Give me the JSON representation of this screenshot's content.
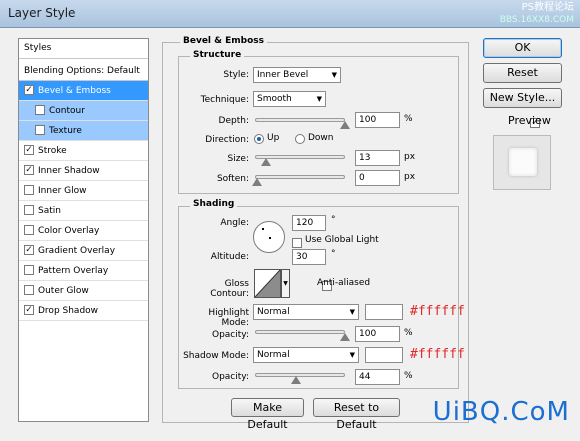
{
  "window": {
    "title": "Layer Style",
    "watermark_top_line1": "PS教程论坛",
    "watermark_top_line2": "BBS.16XX8.COM"
  },
  "sidebar": {
    "header": "Styles",
    "blending": "Blending Options: Default",
    "items": [
      {
        "label": "Bevel & Emboss",
        "checked": true
      },
      {
        "label": "Contour",
        "checked": false
      },
      {
        "label": "Texture",
        "checked": false
      },
      {
        "label": "Stroke",
        "checked": true
      },
      {
        "label": "Inner Shadow",
        "checked": true
      },
      {
        "label": "Inner Glow",
        "checked": false
      },
      {
        "label": "Satin",
        "checked": false
      },
      {
        "label": "Color Overlay",
        "checked": false
      },
      {
        "label": "Gradient Overlay",
        "checked": true
      },
      {
        "label": "Pattern Overlay",
        "checked": false
      },
      {
        "label": "Outer Glow",
        "checked": false
      },
      {
        "label": "Drop Shadow",
        "checked": true
      }
    ]
  },
  "bevel": {
    "title": "Bevel & Emboss",
    "structure_title": "Structure",
    "style_label": "Style:",
    "style_value": "Inner Bevel",
    "technique_label": "Technique:",
    "technique_value": "Smooth",
    "depth_label": "Depth:",
    "depth_value": "100",
    "depth_unit": "%",
    "depth_level": 1.0,
    "direction_label": "Direction:",
    "dir_up": "Up",
    "dir_down": "Down",
    "size_label": "Size:",
    "size_value": "13",
    "size_unit": "px",
    "soften_label": "Soften:",
    "soften_value": "0",
    "soften_unit": "px"
  },
  "shading": {
    "title": "Shading",
    "angle_label": "Angle:",
    "angle_value": "120",
    "angle_unit": "°",
    "use_global_light": "Use Global Light",
    "altitude_label": "Altitude:",
    "altitude_value": "30",
    "altitude_unit": "°",
    "gloss_contour_label": "Gloss Contour:",
    "anti_aliased": "Anti-aliased",
    "highlight_mode_label": "Highlight Mode:",
    "highlight_mode_value": "Normal",
    "highlight_color": "#ffffff",
    "highlight_hex": "#ffffff",
    "highlight_opacity_label": "Opacity:",
    "highlight_opacity_value": "100",
    "highlight_opacity_unit": "%",
    "shadow_mode_label": "Shadow Mode:",
    "shadow_mode_value": "Normal",
    "shadow_color": "#ffffff",
    "shadow_hex": "#ffffff",
    "shadow_opacity_label": "Opacity:",
    "shadow_opacity_value": "44",
    "shadow_opacity_unit": "%",
    "make_default": "Make Default",
    "reset_default": "Reset to Default"
  },
  "buttons": {
    "ok": "OK",
    "reset": "Reset",
    "new_style": "New Style...",
    "preview": "Preview"
  },
  "watermark_bottom": "UiBQ.CoM",
  "colors": {
    "selection": "#3399ff",
    "subselection": "#99c9ff",
    "hex_text": "#e02a2a"
  }
}
